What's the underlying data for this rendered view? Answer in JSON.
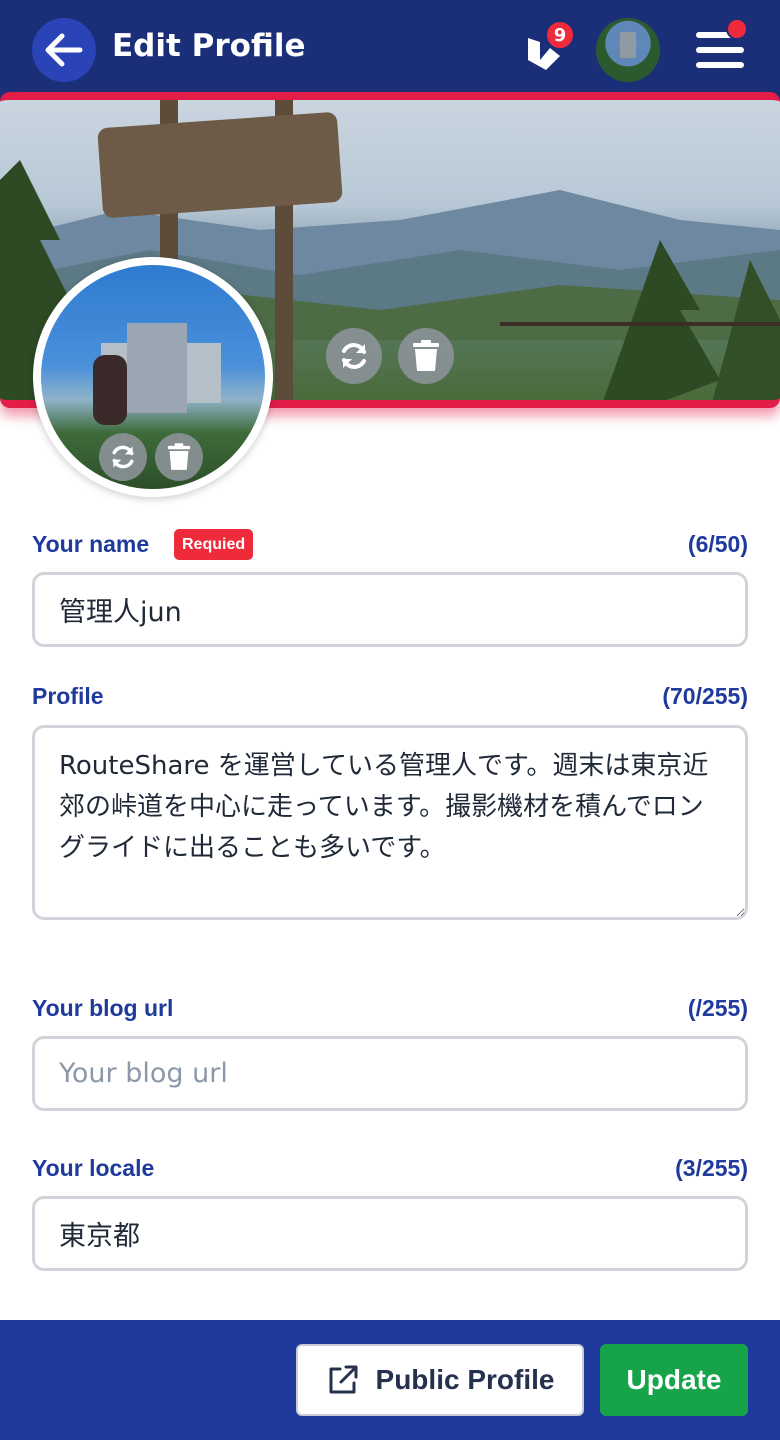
{
  "header": {
    "title": "Edit Profile",
    "notification_count": "9",
    "icons": {
      "back": "arrow-left-icon",
      "logo": "app-logo-icon",
      "menu": "hamburger-menu-icon"
    }
  },
  "cover": {
    "icons": [
      "refresh-icon",
      "trash-icon"
    ]
  },
  "avatar": {
    "icons": [
      "refresh-icon",
      "trash-icon"
    ]
  },
  "form": {
    "name": {
      "label": "Your name",
      "required_badge": "Requied",
      "count": "(6/50)",
      "value": "管理人jun"
    },
    "profile": {
      "label": "Profile",
      "count": "(70/255)",
      "value": "RouteShare を運営している管理人です。週末は東京近郊の峠道を中心に走っています。撮影機材を積んでロングライドに出ることも多いです。"
    },
    "blog_url": {
      "label": "Your blog url",
      "count": "(/255)",
      "value": "",
      "placeholder": "Your blog url"
    },
    "locale": {
      "label": "Your locale",
      "count": "(3/255)",
      "value": "東京都"
    }
  },
  "footer": {
    "public_profile_label": "Public Profile",
    "update_label": "Update",
    "icons": {
      "public_profile": "external-link-icon"
    }
  },
  "colors": {
    "header_bg": "#1b2f78",
    "accent_red": "#e11d48",
    "label_blue": "#1e3a9c",
    "update_green": "#16a34a",
    "footer_bg": "#1e3a9c"
  }
}
